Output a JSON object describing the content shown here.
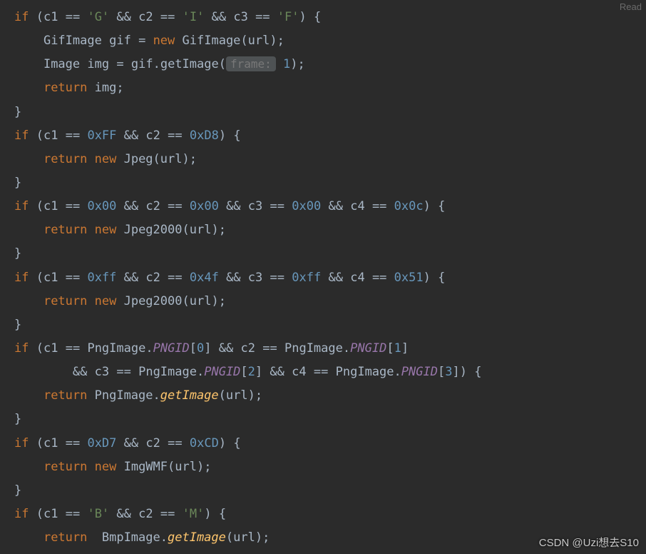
{
  "topright": "Read",
  "watermark": "CSDN @Uzi想去S10",
  "code": {
    "kw_if": "if",
    "kw_return": "return",
    "kw_new": "new",
    "lp": "(",
    "rp": ")",
    "lb": "{",
    "rb": "}",
    "sc": ";",
    "dot": ".",
    "comma": ",",
    "amp": "&&",
    "eq": "==",
    "eqa": "=",
    "lsq": "[",
    "rsq": "]",
    "c1": "c1",
    "c2": "c2",
    "c3": "c3",
    "c4": "c4",
    "g": "'G'",
    "i": "'I'",
    "f": "'F'",
    "b": "'B'",
    "m": "'M'",
    "xff": "0xFF",
    "xd8": "0xD8",
    "x00": "0x00",
    "x0c": "0x0c",
    "xff2": "0xff",
    "x4f": "0x4f",
    "x51": "0x51",
    "xd7": "0xD7",
    "xcd": "0xCD",
    "n0": "0",
    "n1": "1",
    "n2": "2",
    "n3": "3",
    "GifImage": "GifImage",
    "gif": "gif",
    "Image": "Image",
    "img": "img",
    "url": "url",
    "getImage": "getImage",
    "Jpeg": "Jpeg",
    "Jpeg2000": "Jpeg2000",
    "PngImage": "PngImage",
    "PNGID": "PNGID",
    "ImgWMF": "ImgWMF",
    "BmpImage": "BmpImage",
    "framehint": "frame:",
    "framehint_sp": " "
  }
}
